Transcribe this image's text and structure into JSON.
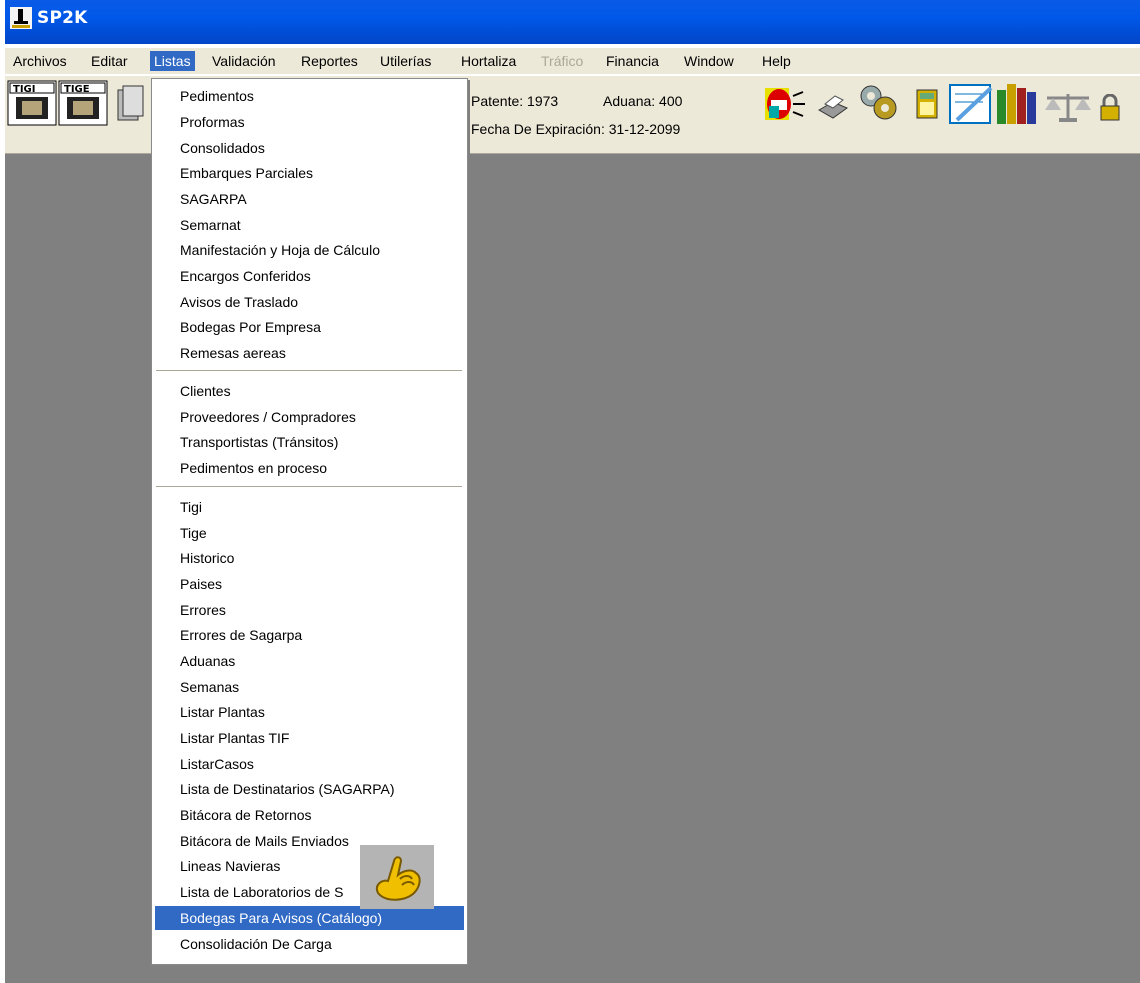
{
  "window": {
    "title": "SP2K"
  },
  "menubar": {
    "items": [
      {
        "label": "Archivos"
      },
      {
        "label": "Editar"
      },
      {
        "label": "Listas"
      },
      {
        "label": "Validación"
      },
      {
        "label": "Reportes"
      },
      {
        "label": "Utilerías"
      },
      {
        "label": "Hortaliza"
      },
      {
        "label": "Tráfico"
      },
      {
        "label": "Financia"
      },
      {
        "label": "Window"
      },
      {
        "label": "Help"
      }
    ],
    "active": "Listas",
    "disabled": "Tráfico"
  },
  "toolbar": {
    "tigi_label": "TIGI",
    "tige_label": "TIGE",
    "patente": "Patente: 1973",
    "aduana": "Aduana: 400",
    "fecha": "Fecha De Expiración: 31-12-2099"
  },
  "listas_menu": {
    "group1": [
      "Pedimentos",
      "Proformas",
      "Consolidados",
      "Embarques Parciales",
      "SAGARPA",
      "Semarnat",
      "Manifestación y Hoja de Cálculo",
      "Encargos Conferidos",
      "Avisos de Traslado",
      "Bodegas Por Empresa",
      "Remesas aereas"
    ],
    "group2": [
      "Clientes",
      "Proveedores / Compradores",
      "Transportistas (Tránsitos)",
      "Pedimentos en proceso"
    ],
    "group3": [
      "Tigi",
      "Tige",
      "Historico",
      "Paises",
      "Errores",
      "Errores de Sagarpa",
      "Aduanas",
      "Semanas",
      "Listar Plantas",
      "Listar Plantas TIF",
      "ListarCasos",
      "Lista de Destinatarios (SAGARPA)",
      "Bitácora de Retornos",
      "Bitácora de Mails Enviados",
      "Lineas Navieras",
      "Lista de Laboratorios de S",
      "Bodegas Para Avisos (Catálogo)",
      "Consolidación De Carga"
    ],
    "selected": "Bodegas Para Avisos (Catálogo)"
  },
  "icons": {
    "app": "app-icon",
    "cursor": "hand-pointer-icon"
  },
  "colors": {
    "titlebar": "#0058e8",
    "menu_bg": "#ece9d8",
    "highlight": "#316ac5",
    "workspace": "#808080"
  }
}
